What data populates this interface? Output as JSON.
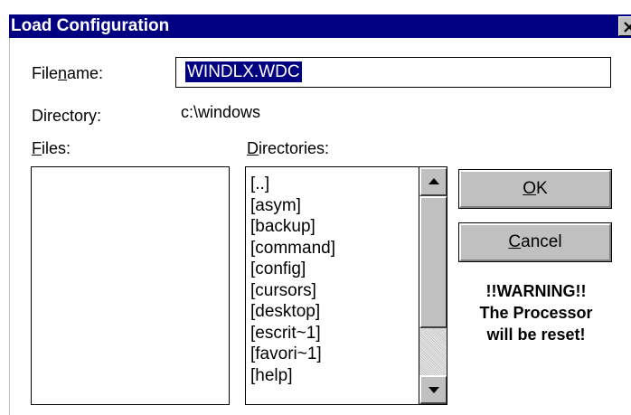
{
  "window": {
    "title": "Load Configuration",
    "close_icon": "close-x-icon"
  },
  "filename": {
    "label_pre": "File",
    "label_mnemonic": "n",
    "label_post": "ame:",
    "value": "WINDLX.WDC"
  },
  "directory": {
    "label": "Directory:",
    "value": "c:\\windows"
  },
  "files": {
    "label_mnemonic": "F",
    "label_post": "iles:",
    "items": []
  },
  "directories": {
    "label_mnemonic": "D",
    "label_post": "irectories:",
    "items": [
      "[..]",
      "[asym]",
      "[backup]",
      "[command]",
      "[config]",
      "[cursors]",
      "[desktop]",
      "[escrit~1]",
      "[favori~1]",
      "[help]"
    ],
    "scroll_up_icon": "scroll-up-arrow-icon",
    "scroll_down_icon": "scroll-down-arrow-icon"
  },
  "buttons": {
    "ok_mnemonic": "O",
    "ok_post": "K",
    "cancel_mnemonic": "C",
    "cancel_post": "ancel"
  },
  "warning": {
    "line1": "!!WARNING!!",
    "line2": "The Processor",
    "line3": "will be reset!"
  },
  "colors": {
    "titlebar": "#000080",
    "face": "#c0c0c0",
    "selection": "#000080"
  }
}
